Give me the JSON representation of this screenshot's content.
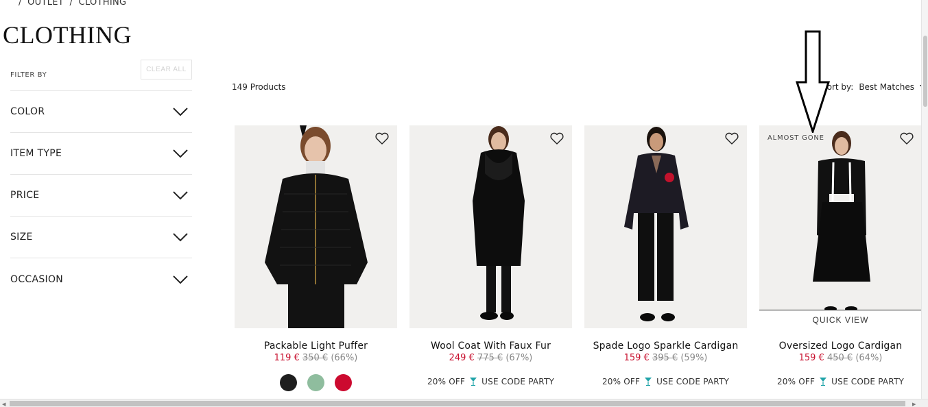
{
  "breadcrumb": {
    "sep1": "/",
    "outlet": "OUTLET",
    "sep2": "/",
    "clothing": "CLOTHING"
  },
  "page_title": "CLOTHING",
  "filters": {
    "filter_by": "FILTER BY",
    "clear_all": "CLEAR ALL",
    "items": [
      {
        "label": "COLOR"
      },
      {
        "label": "ITEM TYPE"
      },
      {
        "label": "PRICE"
      },
      {
        "label": "SIZE"
      },
      {
        "label": "OCCASION"
      }
    ]
  },
  "listing": {
    "count": "149 Products",
    "sort_label": "Sort by:",
    "sort_value": "Best Matches"
  },
  "products": [
    {
      "name": "Packable Light Puffer",
      "sale_price": "119 €",
      "original_price": "350 €",
      "discount": "(66%)",
      "swatches": [
        "#1e1e1e",
        "#8fbd9e",
        "#cc0a2f"
      ]
    },
    {
      "name": "Wool Coat With Faux Fur",
      "sale_price": "249 €",
      "original_price": "775 €",
      "discount": "(67%)",
      "promo_off": "20% OFF",
      "promo_code": "USE CODE PARTY"
    },
    {
      "name": "Spade Logo Sparkle Cardigan",
      "sale_price": "159 €",
      "original_price": "395 €",
      "discount": "(59%)",
      "promo_off": "20% OFF",
      "promo_code": "USE CODE PARTY"
    },
    {
      "name": "Oversized Logo Cardigan",
      "sale_price": "159 €",
      "original_price": "450 €",
      "discount": "(64%)",
      "badge": "ALMOST GONE",
      "quick_view": "QUICK VIEW",
      "promo_off": "20% OFF",
      "promo_code": "USE CODE PARTY"
    }
  ],
  "colors": {
    "sale": "#c8102e",
    "promo_icon": "#1fa3a8",
    "image_bg": "#f1f0ee"
  }
}
